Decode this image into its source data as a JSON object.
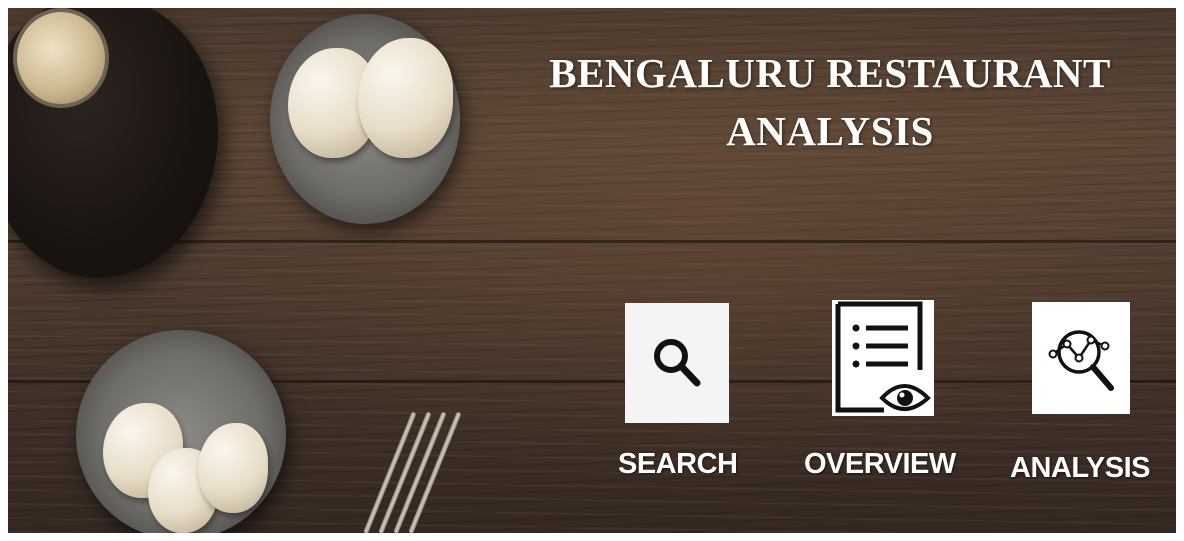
{
  "title": {
    "line1": "BENGALURU RESTAURANT",
    "line2": "ANALYSIS"
  },
  "nav": [
    {
      "label": "SEARCH",
      "icon": "search-icon"
    },
    {
      "label": "OVERVIEW",
      "icon": "document-eye-icon"
    },
    {
      "label": "ANALYSIS",
      "icon": "analytics-magnifier-icon"
    }
  ],
  "colors": {
    "title_text": "#ffffff",
    "tile_background": "#ffffff",
    "icon_stroke": "#111111",
    "wood_dark": "#352821",
    "wood_light": "#5a4536"
  }
}
